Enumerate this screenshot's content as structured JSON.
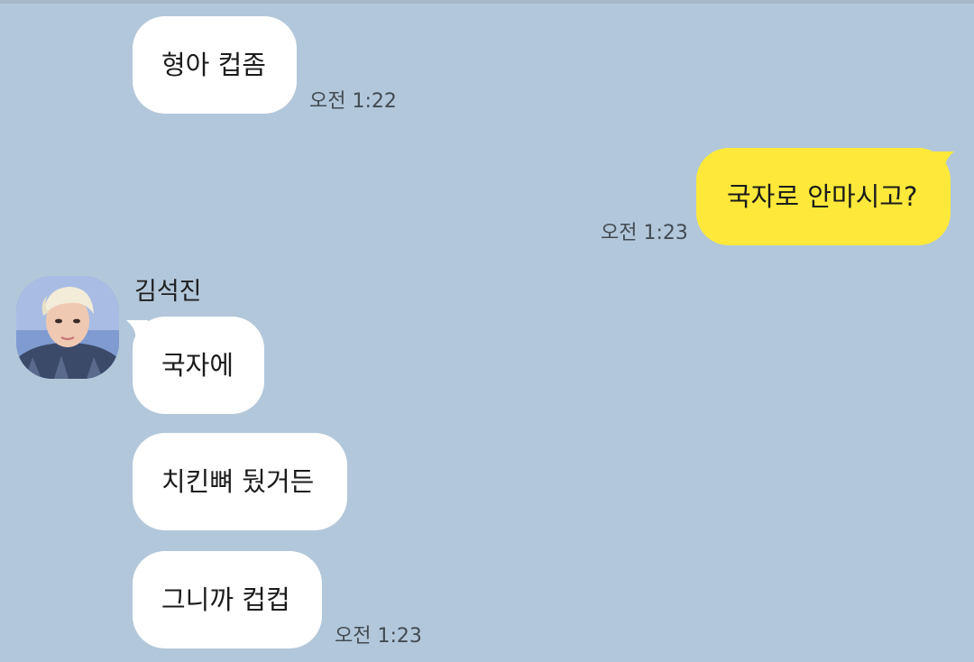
{
  "chat": {
    "messages": [
      {
        "side": "in",
        "text": "형아 컵좀",
        "time": "오전 1:22"
      },
      {
        "side": "out",
        "text": "국자로 안마시고?",
        "time": "오전 1:23"
      },
      {
        "side": "in",
        "sender": "김석진",
        "text": "국자에"
      },
      {
        "side": "in",
        "text": "치킨뼈 뒀거든"
      },
      {
        "side": "in",
        "text": "그니까 컵컵",
        "time": "오전 1:23"
      }
    ]
  },
  "colors": {
    "background": "#b2c7da",
    "incoming_bubble": "#ffffff",
    "outgoing_bubble": "#fee93a",
    "time_text": "#434b52"
  },
  "icons": {
    "avatar": "profile-photo"
  }
}
